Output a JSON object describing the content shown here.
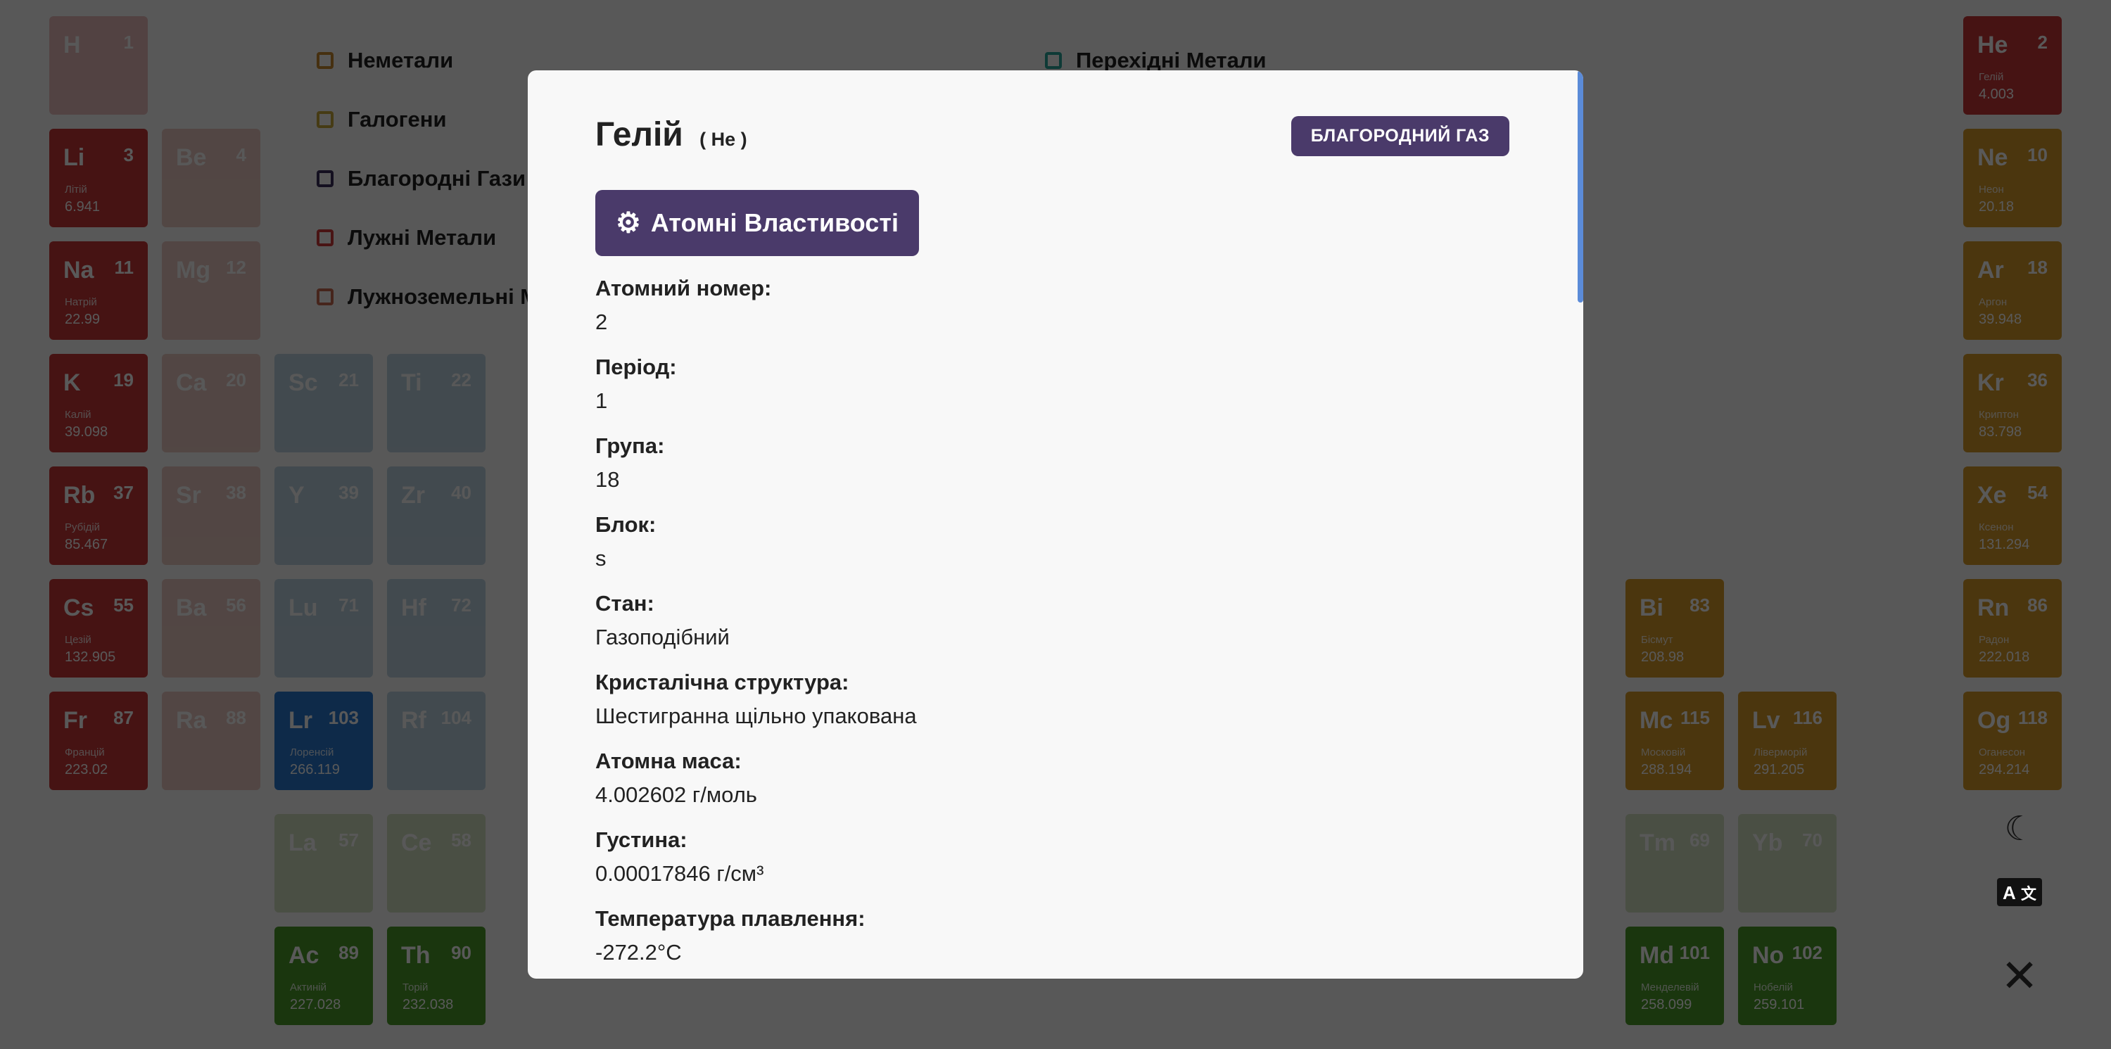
{
  "legend": [
    {
      "label": "Неметали",
      "color": "#c98a2e"
    },
    {
      "label": "Галогени",
      "color": "#c9a83a"
    },
    {
      "label": "Благородні Гази",
      "color": "#3a2f5c"
    },
    {
      "label": "Лужні Метали",
      "color": "#d13b3b"
    },
    {
      "label": "Лужноземельні Метали",
      "color": "#c96a50"
    },
    {
      "label": "Перехідні Метали",
      "color": "#2aa59b"
    }
  ],
  "elements": [
    {
      "sym": "H",
      "num": "1",
      "name": "",
      "mass": "",
      "color": "#c94a4a",
      "col": 0,
      "row": 0,
      "faded": true
    },
    {
      "sym": "He",
      "num": "2",
      "name": "Гелій",
      "mass": "4.003",
      "color": "#c83838",
      "col": 17,
      "row": 0,
      "faded": false
    },
    {
      "sym": "Li",
      "num": "3",
      "name": "Літій",
      "mass": "6.941",
      "color": "#c83838",
      "col": 0,
      "row": 1,
      "faded": false
    },
    {
      "sym": "Be",
      "num": "4",
      "name": "",
      "mass": "",
      "color": "#c86a5a",
      "col": 1,
      "row": 1,
      "faded": true
    },
    {
      "sym": "Ne",
      "num": "10",
      "name": "Неон",
      "mass": "20.18",
      "color": "#d89a2a",
      "col": 17,
      "row": 1,
      "faded": false
    },
    {
      "sym": "Na",
      "num": "11",
      "name": "Натрій",
      "mass": "22.99",
      "color": "#c83838",
      "col": 0,
      "row": 2,
      "faded": false
    },
    {
      "sym": "Mg",
      "num": "12",
      "name": "",
      "mass": "",
      "color": "#c86a5a",
      "col": 1,
      "row": 2,
      "faded": true
    },
    {
      "sym": "Ar",
      "num": "18",
      "name": "Аргон",
      "mass": "39.948",
      "color": "#d89a2a",
      "col": 17,
      "row": 2,
      "faded": false
    },
    {
      "sym": "K",
      "num": "19",
      "name": "Калій",
      "mass": "39.098",
      "color": "#c83838",
      "col": 0,
      "row": 3,
      "faded": false
    },
    {
      "sym": "Ca",
      "num": "20",
      "name": "",
      "mass": "",
      "color": "#c86a5a",
      "col": 1,
      "row": 3,
      "faded": true
    },
    {
      "sym": "Sc",
      "num": "21",
      "name": "",
      "mass": "",
      "color": "#4a8ab0",
      "col": 2,
      "row": 3,
      "faded": true
    },
    {
      "sym": "Ti",
      "num": "22",
      "name": "",
      "mass": "",
      "color": "#4a8ab0",
      "col": 3,
      "row": 3,
      "faded": true
    },
    {
      "sym": "Kr",
      "num": "36",
      "name": "Криптон",
      "mass": "83.798",
      "color": "#d89a2a",
      "col": 17,
      "row": 3,
      "faded": false
    },
    {
      "sym": "Rb",
      "num": "37",
      "name": "Рубідій",
      "mass": "85.467",
      "color": "#c83838",
      "col": 0,
      "row": 4,
      "faded": false
    },
    {
      "sym": "Sr",
      "num": "38",
      "name": "",
      "mass": "",
      "color": "#c86a5a",
      "col": 1,
      "row": 4,
      "faded": true
    },
    {
      "sym": "Y",
      "num": "39",
      "name": "",
      "mass": "",
      "color": "#4a8ab0",
      "col": 2,
      "row": 4,
      "faded": true
    },
    {
      "sym": "Zr",
      "num": "40",
      "name": "",
      "mass": "",
      "color": "#4a8ab0",
      "col": 3,
      "row": 4,
      "faded": true
    },
    {
      "sym": "Xe",
      "num": "54",
      "name": "Ксенон",
      "mass": "131.294",
      "color": "#d89a2a",
      "col": 17,
      "row": 4,
      "faded": false
    },
    {
      "sym": "Cs",
      "num": "55",
      "name": "Цезій",
      "mass": "132.905",
      "color": "#c83838",
      "col": 0,
      "row": 5,
      "faded": false
    },
    {
      "sym": "Ba",
      "num": "56",
      "name": "",
      "mass": "",
      "color": "#c86a5a",
      "col": 1,
      "row": 5,
      "faded": true
    },
    {
      "sym": "Lu",
      "num": "71",
      "name": "",
      "mass": "",
      "color": "#4a8ab0",
      "col": 2,
      "row": 5,
      "faded": true
    },
    {
      "sym": "Hf",
      "num": "72",
      "name": "",
      "mass": "",
      "color": "#4a8ab0",
      "col": 3,
      "row": 5,
      "faded": true
    },
    {
      "sym": "Bi",
      "num": "83",
      "name": "Бісмут",
      "mass": "208.98",
      "color": "#d89a2a",
      "col": 14,
      "row": 5,
      "faded": false
    },
    {
      "sym": "Rn",
      "num": "86",
      "name": "Радон",
      "mass": "222.018",
      "color": "#d89a2a",
      "col": 17,
      "row": 5,
      "faded": false
    },
    {
      "sym": "Fr",
      "num": "87",
      "name": "Францій",
      "mass": "223.02",
      "color": "#c83838",
      "col": 0,
      "row": 6,
      "faded": false
    },
    {
      "sym": "Ra",
      "num": "88",
      "name": "",
      "mass": "",
      "color": "#c86a5a",
      "col": 1,
      "row": 6,
      "faded": true
    },
    {
      "sym": "Lr",
      "num": "103",
      "name": "Лоренсій",
      "mass": "266.119",
      "color": "#2a7ad0",
      "col": 2,
      "row": 6,
      "faded": false
    },
    {
      "sym": "Rf",
      "num": "104",
      "name": "",
      "mass": "",
      "color": "#4a8ab0",
      "col": 3,
      "row": 6,
      "faded": true
    },
    {
      "sym": "Mc",
      "num": "115",
      "name": "Московій",
      "mass": "288.194",
      "color": "#d89a2a",
      "col": 14,
      "row": 6,
      "faded": false
    },
    {
      "sym": "Lv",
      "num": "116",
      "name": "Ліверморій",
      "mass": "291.205",
      "color": "#d89a2a",
      "col": 15,
      "row": 6,
      "faded": false
    },
    {
      "sym": "Og",
      "num": "118",
      "name": "Оганесон",
      "mass": "294.214",
      "color": "#d89a2a",
      "col": 17,
      "row": 6,
      "faded": false
    },
    {
      "sym": "La",
      "num": "57",
      "name": "",
      "mass": "",
      "color": "#8ab05a",
      "col": 2,
      "row": 7,
      "faded": true
    },
    {
      "sym": "Ce",
      "num": "58",
      "name": "",
      "mass": "",
      "color": "#8ab05a",
      "col": 3,
      "row": 7,
      "faded": true
    },
    {
      "sym": "Tm",
      "num": "69",
      "name": "",
      "mass": "",
      "color": "#8ab05a",
      "col": 14,
      "row": 7,
      "faded": true
    },
    {
      "sym": "Yb",
      "num": "70",
      "name": "",
      "mass": "",
      "color": "#8ab05a",
      "col": 15,
      "row": 7,
      "faded": true
    },
    {
      "sym": "Ac",
      "num": "89",
      "name": "Актиній",
      "mass": "227.028",
      "color": "#4a9a2a",
      "col": 2,
      "row": 8,
      "faded": false
    },
    {
      "sym": "Th",
      "num": "90",
      "name": "Торій",
      "mass": "232.038",
      "color": "#4a9a2a",
      "col": 3,
      "row": 8,
      "faded": false
    },
    {
      "sym": "Md",
      "num": "101",
      "name": "Менделевій",
      "mass": "258.099",
      "color": "#4a9a2a",
      "col": 14,
      "row": 8,
      "faded": false
    },
    {
      "sym": "No",
      "num": "102",
      "name": "Нобелій",
      "mass": "259.101",
      "color": "#4a9a2a",
      "col": 15,
      "row": 8,
      "faded": false
    }
  ],
  "modal": {
    "title": "Гелій",
    "symbol": "( He )",
    "badge": "БЛАГОРОДНИЙ ГАЗ",
    "tab_label": "Атомні Властивості",
    "properties": [
      {
        "label": "Атомний номер:",
        "value": "2"
      },
      {
        "label": "Період:",
        "value": "1"
      },
      {
        "label": "Група:",
        "value": "18"
      },
      {
        "label": "Блок:",
        "value": "s"
      },
      {
        "label": "Стан:",
        "value": "Газоподібний"
      },
      {
        "label": "Кристалічна структура:",
        "value": "Шестигранна щільно упакована"
      },
      {
        "label": "Атомна маса:",
        "value": "4.002602 г/моль"
      },
      {
        "label": "Густина:",
        "value": "0.00017846 г/см³"
      },
      {
        "label": "Температура плавлення:",
        "value": "-272.2°C"
      }
    ]
  },
  "side_controls": {
    "theme_icon": "moon-icon",
    "language_icon": "translate-icon",
    "close_icon": "close-icon"
  }
}
